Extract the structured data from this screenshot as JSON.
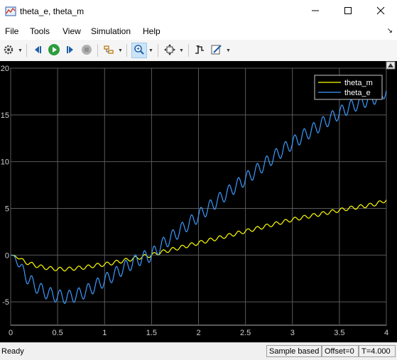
{
  "window": {
    "title": "theta_e, theta_m",
    "app_icon": "scope-icon"
  },
  "menubar": {
    "items": [
      "File",
      "Tools",
      "View",
      "Simulation",
      "Help"
    ]
  },
  "toolbar": {
    "buttons": [
      "settings-icon",
      "step-back-icon",
      "run-icon",
      "step-forward-icon",
      "stop-icon",
      "signal-highlight-icon",
      "zoom-icon",
      "autoscale-icon",
      "triggers-icon",
      "style-icon"
    ]
  },
  "status": {
    "ready": "Ready",
    "mode": "Sample based",
    "offset": "Offset=0",
    "time": "T=4.000"
  },
  "chart_data": {
    "type": "line",
    "title": "",
    "xlabel": "",
    "ylabel": "",
    "xlim": [
      0,
      4
    ],
    "ylim": [
      -7.5,
      20
    ],
    "xticks": [
      "0",
      "0.5",
      "1",
      "1.5",
      "2",
      "2.5",
      "3",
      "3.5",
      "4"
    ],
    "yticks": [
      "-5",
      "0",
      "5",
      "10",
      "15",
      "20"
    ],
    "grid": true,
    "legend_position": "top-right",
    "background": "#000000",
    "series": [
      {
        "name": "theta_m",
        "color": "#ffff00",
        "x": [
          0,
          0.05,
          0.1,
          0.15,
          0.2,
          0.3,
          0.4,
          0.5,
          0.6,
          0.7,
          0.8,
          0.9,
          1.0,
          1.1,
          1.2,
          1.3,
          1.4,
          1.5,
          1.6,
          1.8,
          2.0,
          2.2,
          2.4,
          2.6,
          2.8,
          3.0,
          3.2,
          3.4,
          3.6,
          3.8,
          3.9,
          4.0
        ],
        "y": [
          0,
          -0.1,
          -0.4,
          -0.7,
          -0.9,
          -1.2,
          -1.4,
          -1.5,
          -1.5,
          -1.4,
          -1.3,
          -1.1,
          -1.0,
          -0.8,
          -0.6,
          -0.4,
          -0.2,
          0.0,
          0.3,
          0.8,
          1.3,
          1.8,
          2.3,
          2.8,
          3.3,
          3.8,
          4.2,
          4.6,
          5.0,
          5.3,
          5.5,
          5.9
        ],
        "oscillation_amplitude": 0.2
      },
      {
        "name": "theta_e",
        "color": "#3b9bff",
        "x": [
          0,
          0.05,
          0.1,
          0.15,
          0.2,
          0.3,
          0.4,
          0.5,
          0.6,
          0.7,
          0.8,
          0.9,
          1.0,
          1.1,
          1.2,
          1.3,
          1.4,
          1.5,
          1.6,
          1.8,
          2.0,
          2.2,
          2.4,
          2.6,
          2.8,
          3.0,
          3.2,
          3.4,
          3.6,
          3.8,
          3.9,
          4.0
        ],
        "y": [
          0,
          -0.3,
          -1.2,
          -2.0,
          -2.7,
          -3.6,
          -4.1,
          -4.4,
          -4.5,
          -4.3,
          -3.9,
          -3.3,
          -2.7,
          -2.1,
          -1.4,
          -0.8,
          -0.3,
          0.0,
          1.0,
          2.6,
          4.2,
          5.8,
          7.4,
          8.9,
          10.5,
          12.0,
          13.3,
          14.6,
          15.8,
          16.6,
          16.9,
          17.6
        ],
        "oscillation_amplitude": 0.7
      }
    ],
    "oscillation_period": 0.1
  }
}
